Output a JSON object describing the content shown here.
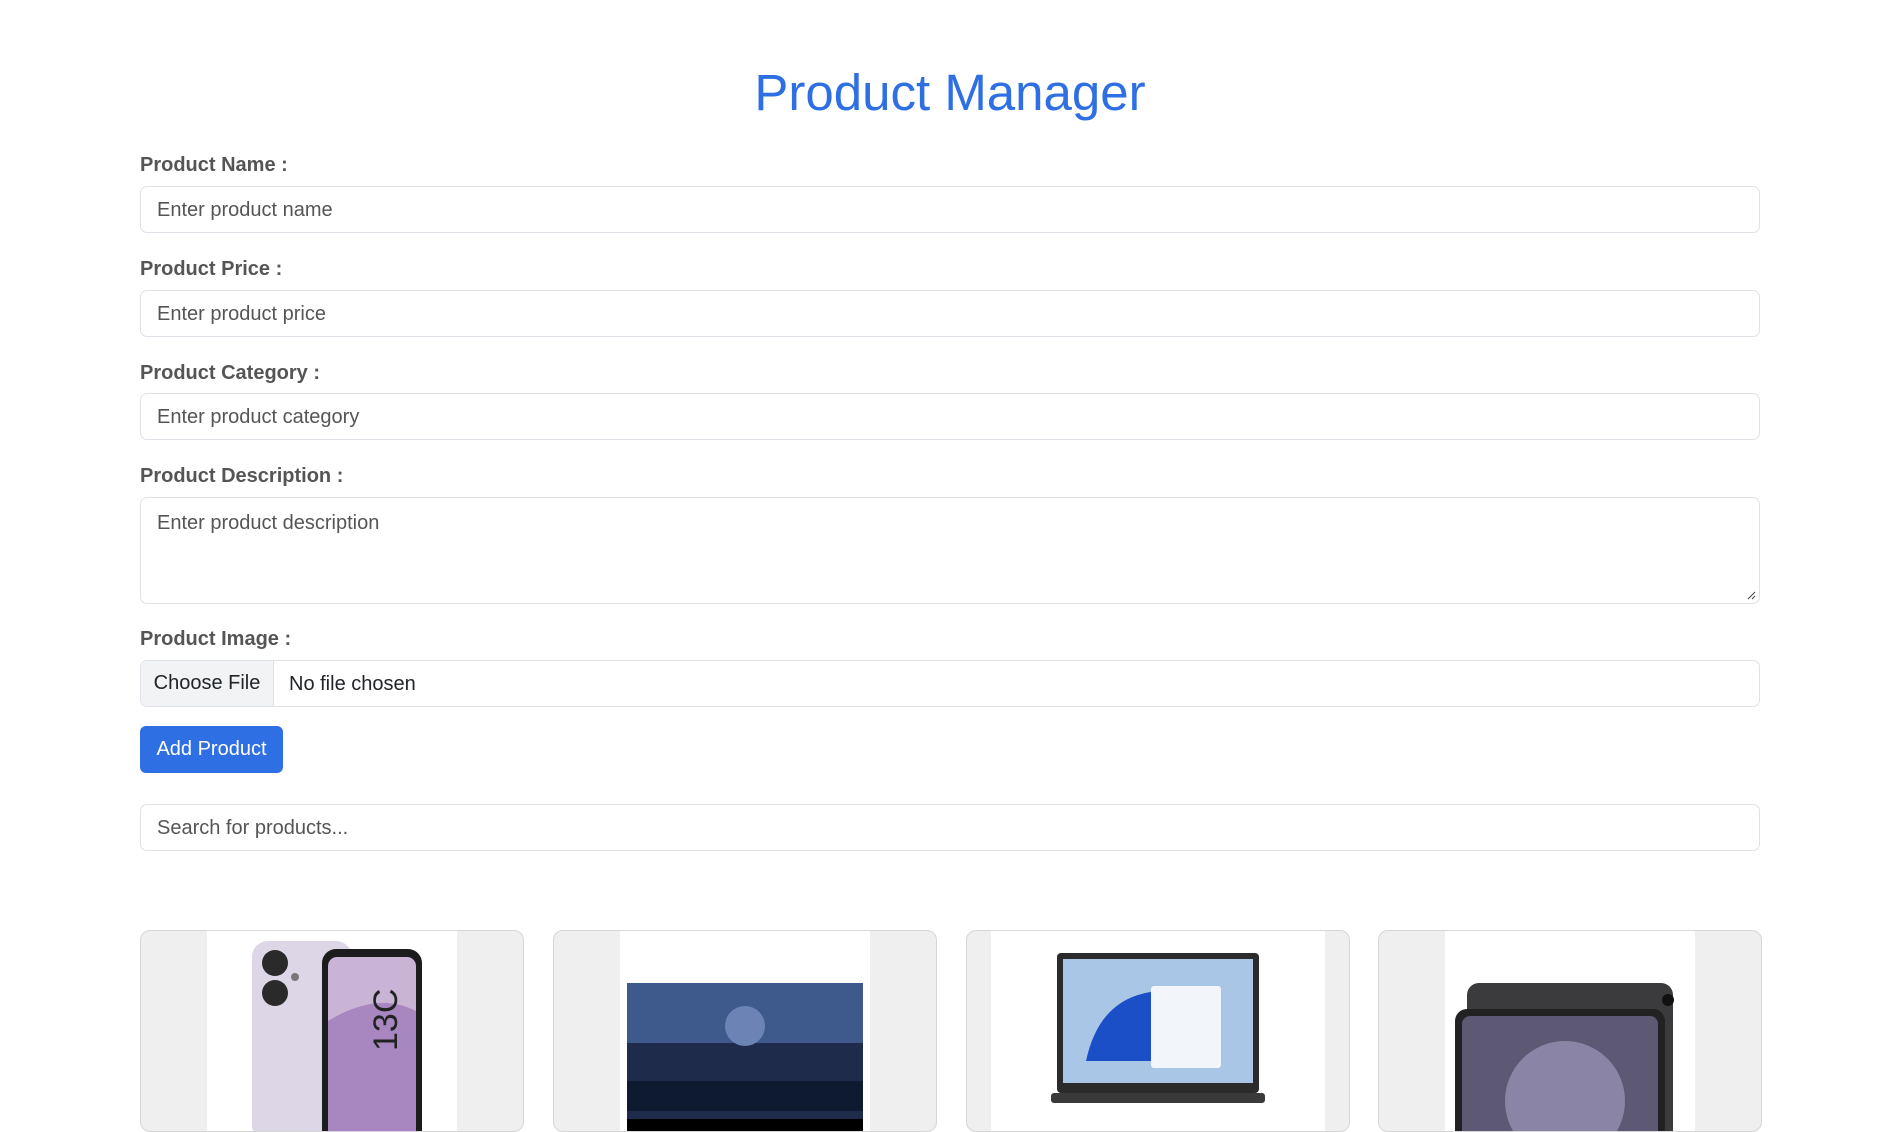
{
  "header": {
    "title": "Product Manager"
  },
  "form": {
    "name": {
      "label": "Product Name :",
      "placeholder": "Enter product name"
    },
    "price": {
      "label": "Product Price :",
      "placeholder": "Enter product price"
    },
    "category": {
      "label": "Product Category :",
      "placeholder": "Enter product category"
    },
    "description": {
      "label": "Product Description :",
      "placeholder": "Enter product description"
    },
    "image": {
      "label": "Product Image :",
      "button": "Choose File",
      "status": "No file chosen"
    },
    "submit": "Add Product"
  },
  "search": {
    "placeholder": "Search for products..."
  },
  "products": [
    {
      "image": "redmi-13c-phone"
    },
    {
      "image": "lg-webos-tv"
    },
    {
      "image": "windows-laptop"
    },
    {
      "image": "samsung-tablet"
    }
  ],
  "colors": {
    "accent": "#2f6fe4",
    "border": "#dee2e6"
  }
}
